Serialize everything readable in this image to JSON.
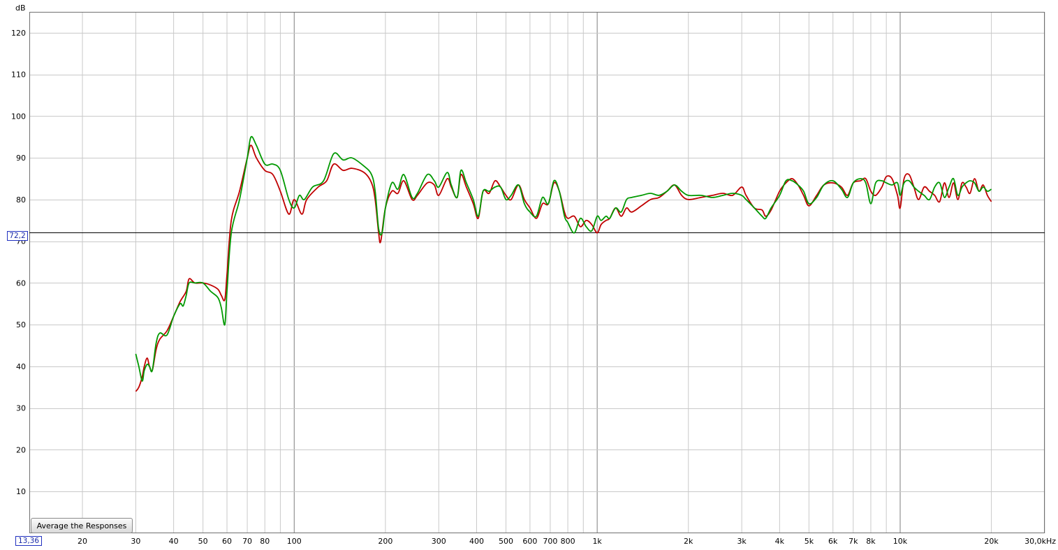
{
  "chart_data": {
    "type": "line",
    "title": "",
    "xlabel": "",
    "ylabel": "dB",
    "x_unit": "Hz",
    "x_scale": "log",
    "xlim": [
      13.36,
      30000
    ],
    "ylim": [
      0,
      125
    ],
    "grid": true,
    "x_ticks": [
      {
        "value": 20,
        "label": "20"
      },
      {
        "value": 30,
        "label": "30"
      },
      {
        "value": 40,
        "label": "40"
      },
      {
        "value": 50,
        "label": "50"
      },
      {
        "value": 60,
        "label": "60"
      },
      {
        "value": 70,
        "label": "70"
      },
      {
        "value": 80,
        "label": "80"
      },
      {
        "value": 100,
        "label": "100"
      },
      {
        "value": 200,
        "label": "200"
      },
      {
        "value": 300,
        "label": "300"
      },
      {
        "value": 400,
        "label": "400"
      },
      {
        "value": 500,
        "label": "500"
      },
      {
        "value": 600,
        "label": "600"
      },
      {
        "value": 700,
        "label": "700"
      },
      {
        "value": 800,
        "label": "800"
      },
      {
        "value": 1000,
        "label": "1k"
      },
      {
        "value": 2000,
        "label": "2k"
      },
      {
        "value": 3000,
        "label": "3k"
      },
      {
        "value": 4000,
        "label": "4k"
      },
      {
        "value": 5000,
        "label": "5k"
      },
      {
        "value": 6000,
        "label": "6k"
      },
      {
        "value": 7000,
        "label": "7k"
      },
      {
        "value": 8000,
        "label": "8k"
      },
      {
        "value": 10000,
        "label": "10k"
      },
      {
        "value": 20000,
        "label": "20k"
      },
      {
        "value": 30000,
        "label": "30,0kHz"
      }
    ],
    "x_gridlines": [
      20,
      30,
      40,
      50,
      60,
      70,
      80,
      90,
      100,
      200,
      300,
      400,
      500,
      600,
      700,
      800,
      900,
      1000,
      2000,
      3000,
      4000,
      5000,
      6000,
      7000,
      8000,
      9000,
      10000,
      20000,
      30000
    ],
    "x_major_gridlines": [
      100,
      1000,
      10000
    ],
    "y_ticks": [
      10,
      20,
      30,
      40,
      50,
      60,
      70,
      80,
      90,
      100,
      110,
      120
    ],
    "reference_line": {
      "y": 72.2,
      "label": "72,2"
    },
    "x_cursor_label": "13,36",
    "series": [
      {
        "color": "#c00000",
        "points": [
          [
            30,
            34
          ],
          [
            30.7,
            35
          ],
          [
            31.5,
            37.5
          ],
          [
            32,
            40
          ],
          [
            32.7,
            42
          ],
          [
            33.3,
            40
          ],
          [
            34,
            39
          ],
          [
            35,
            44
          ],
          [
            36,
            46.5
          ],
          [
            38,
            48.5
          ],
          [
            40,
            52
          ],
          [
            42,
            55.5
          ],
          [
            44,
            58
          ],
          [
            45,
            61
          ],
          [
            47,
            60
          ],
          [
            50,
            60
          ],
          [
            53,
            59.5
          ],
          [
            56,
            58.5
          ],
          [
            57.5,
            57
          ],
          [
            59,
            56
          ],
          [
            60,
            62
          ],
          [
            62,
            75
          ],
          [
            66,
            82
          ],
          [
            70,
            90
          ],
          [
            72,
            93
          ],
          [
            75,
            90
          ],
          [
            80,
            87
          ],
          [
            85,
            86
          ],
          [
            90,
            82
          ],
          [
            96,
            76.5
          ],
          [
            100,
            80
          ],
          [
            106,
            76.5
          ],
          [
            110,
            80
          ],
          [
            120,
            83
          ],
          [
            128,
            84.5
          ],
          [
            135,
            88.5
          ],
          [
            145,
            87
          ],
          [
            155,
            87.5
          ],
          [
            170,
            86.5
          ],
          [
            180,
            84
          ],
          [
            185,
            80
          ],
          [
            190,
            72
          ],
          [
            193,
            70
          ],
          [
            200,
            78
          ],
          [
            210,
            82
          ],
          [
            220,
            81.5
          ],
          [
            230,
            84.5
          ],
          [
            245,
            80
          ],
          [
            255,
            81
          ],
          [
            275,
            84
          ],
          [
            290,
            83.5
          ],
          [
            300,
            81
          ],
          [
            320,
            85
          ],
          [
            330,
            83
          ],
          [
            345,
            80.5
          ],
          [
            355,
            86
          ],
          [
            370,
            83
          ],
          [
            390,
            79
          ],
          [
            405,
            75.5
          ],
          [
            420,
            82
          ],
          [
            440,
            81.5
          ],
          [
            460,
            84.5
          ],
          [
            480,
            83
          ],
          [
            500,
            81
          ],
          [
            520,
            80
          ],
          [
            550,
            83.5
          ],
          [
            575,
            80
          ],
          [
            600,
            78
          ],
          [
            630,
            75.5
          ],
          [
            660,
            79
          ],
          [
            690,
            79
          ],
          [
            720,
            84
          ],
          [
            750,
            82
          ],
          [
            780,
            77
          ],
          [
            800,
            75.5
          ],
          [
            840,
            76
          ],
          [
            880,
            73.5
          ],
          [
            920,
            75
          ],
          [
            960,
            74
          ],
          [
            1000,
            72
          ],
          [
            1030,
            74
          ],
          [
            1070,
            75
          ],
          [
            1100,
            75.5
          ],
          [
            1150,
            78
          ],
          [
            1200,
            76
          ],
          [
            1250,
            78
          ],
          [
            1300,
            77
          ],
          [
            1400,
            78.5
          ],
          [
            1500,
            80
          ],
          [
            1600,
            80.5
          ],
          [
            1700,
            82
          ],
          [
            1800,
            83.5
          ],
          [
            1900,
            81
          ],
          [
            2000,
            80
          ],
          [
            2200,
            80.5
          ],
          [
            2400,
            81
          ],
          [
            2600,
            81.5
          ],
          [
            2800,
            81
          ],
          [
            3000,
            83
          ],
          [
            3100,
            81
          ],
          [
            3300,
            78
          ],
          [
            3500,
            77.5
          ],
          [
            3600,
            76
          ],
          [
            3750,
            77.5
          ],
          [
            4000,
            82
          ],
          [
            4200,
            84
          ],
          [
            4400,
            85
          ],
          [
            4600,
            83.5
          ],
          [
            4800,
            81
          ],
          [
            5000,
            78.5
          ],
          [
            5300,
            81
          ],
          [
            5600,
            83.5
          ],
          [
            6000,
            84
          ],
          [
            6400,
            83
          ],
          [
            6700,
            81
          ],
          [
            7000,
            84
          ],
          [
            7400,
            84.5
          ],
          [
            7700,
            85
          ],
          [
            8000,
            82
          ],
          [
            8300,
            81
          ],
          [
            8700,
            83
          ],
          [
            9000,
            85.5
          ],
          [
            9400,
            85
          ],
          [
            9800,
            81
          ],
          [
            10000,
            78
          ],
          [
            10300,
            85
          ],
          [
            10700,
            86
          ],
          [
            11100,
            83
          ],
          [
            11500,
            80
          ],
          [
            12000,
            83
          ],
          [
            12500,
            82
          ],
          [
            13000,
            81
          ],
          [
            13500,
            79.5
          ],
          [
            14000,
            84
          ],
          [
            14500,
            80.5
          ],
          [
            15000,
            84
          ],
          [
            15500,
            80
          ],
          [
            16000,
            84
          ],
          [
            16500,
            83
          ],
          [
            17000,
            81.5
          ],
          [
            17600,
            85
          ],
          [
            18200,
            82
          ],
          [
            18800,
            83.5
          ],
          [
            19400,
            81
          ],
          [
            20000,
            79.5
          ]
        ]
      },
      {
        "color": "#009900",
        "points": [
          [
            30,
            43
          ],
          [
            30.7,
            40
          ],
          [
            31.5,
            36.5
          ],
          [
            32,
            39
          ],
          [
            32.7,
            40.5
          ],
          [
            33.3,
            40
          ],
          [
            34,
            39
          ],
          [
            35,
            45.5
          ],
          [
            36,
            48
          ],
          [
            38,
            47.5
          ],
          [
            40,
            52
          ],
          [
            42,
            55
          ],
          [
            43,
            54.5
          ],
          [
            44,
            57
          ],
          [
            45,
            60
          ],
          [
            47,
            60
          ],
          [
            50,
            60
          ],
          [
            53,
            58
          ],
          [
            56,
            56.5
          ],
          [
            57.5,
            54
          ],
          [
            59,
            50
          ],
          [
            60,
            58
          ],
          [
            62,
            72
          ],
          [
            66,
            80
          ],
          [
            70,
            90
          ],
          [
            72,
            95
          ],
          [
            75,
            93
          ],
          [
            80,
            88.5
          ],
          [
            85,
            88.5
          ],
          [
            90,
            87
          ],
          [
            96,
            80
          ],
          [
            100,
            78
          ],
          [
            104,
            81
          ],
          [
            108,
            80
          ],
          [
            115,
            83
          ],
          [
            125,
            84.5
          ],
          [
            135,
            91
          ],
          [
            145,
            89.5
          ],
          [
            155,
            90
          ],
          [
            170,
            88
          ],
          [
            180,
            86
          ],
          [
            185,
            82
          ],
          [
            190,
            73
          ],
          [
            195,
            72
          ],
          [
            200,
            78
          ],
          [
            210,
            84
          ],
          [
            220,
            82.5
          ],
          [
            230,
            86
          ],
          [
            245,
            80.5
          ],
          [
            255,
            81.5
          ],
          [
            275,
            86
          ],
          [
            290,
            84.5
          ],
          [
            300,
            83
          ],
          [
            320,
            86.5
          ],
          [
            330,
            83.5
          ],
          [
            345,
            80.5
          ],
          [
            355,
            87
          ],
          [
            370,
            84
          ],
          [
            390,
            80
          ],
          [
            405,
            76
          ],
          [
            420,
            82
          ],
          [
            440,
            82
          ],
          [
            460,
            83
          ],
          [
            480,
            83
          ],
          [
            500,
            80
          ],
          [
            520,
            81
          ],
          [
            550,
            83.5
          ],
          [
            575,
            79
          ],
          [
            600,
            77
          ],
          [
            630,
            76
          ],
          [
            660,
            80.5
          ],
          [
            690,
            79
          ],
          [
            720,
            84.5
          ],
          [
            750,
            82
          ],
          [
            780,
            76
          ],
          [
            800,
            74.5
          ],
          [
            840,
            72
          ],
          [
            880,
            75.5
          ],
          [
            920,
            73.5
          ],
          [
            960,
            72.5
          ],
          [
            1000,
            76
          ],
          [
            1030,
            75
          ],
          [
            1070,
            76
          ],
          [
            1100,
            75.5
          ],
          [
            1150,
            78
          ],
          [
            1200,
            77
          ],
          [
            1250,
            80
          ],
          [
            1300,
            80.5
          ],
          [
            1400,
            81
          ],
          [
            1500,
            81.5
          ],
          [
            1600,
            81
          ],
          [
            1700,
            82
          ],
          [
            1800,
            83.5
          ],
          [
            1900,
            82
          ],
          [
            2000,
            81
          ],
          [
            2200,
            81
          ],
          [
            2400,
            80.5
          ],
          [
            2600,
            81
          ],
          [
            2800,
            81.5
          ],
          [
            3000,
            81
          ],
          [
            3100,
            80
          ],
          [
            3300,
            78
          ],
          [
            3500,
            76
          ],
          [
            3600,
            75.5
          ],
          [
            3750,
            78
          ],
          [
            4000,
            81
          ],
          [
            4200,
            84.5
          ],
          [
            4400,
            84.5
          ],
          [
            4600,
            83.5
          ],
          [
            4800,
            82
          ],
          [
            5000,
            79
          ],
          [
            5300,
            80.5
          ],
          [
            5600,
            83.5
          ],
          [
            6000,
            84.5
          ],
          [
            6400,
            82.5
          ],
          [
            6700,
            80.5
          ],
          [
            7000,
            84
          ],
          [
            7400,
            85
          ],
          [
            7700,
            84
          ],
          [
            8000,
            79
          ],
          [
            8300,
            84
          ],
          [
            8700,
            84.5
          ],
          [
            9000,
            84
          ],
          [
            9400,
            83.5
          ],
          [
            9800,
            84
          ],
          [
            10000,
            81
          ],
          [
            10300,
            84
          ],
          [
            10700,
            84.5
          ],
          [
            11100,
            83
          ],
          [
            11500,
            82
          ],
          [
            12000,
            81
          ],
          [
            12500,
            80
          ],
          [
            13000,
            83
          ],
          [
            13500,
            84
          ],
          [
            14000,
            80.5
          ],
          [
            14500,
            83
          ],
          [
            15000,
            85
          ],
          [
            15500,
            81
          ],
          [
            16000,
            83
          ],
          [
            16500,
            84
          ],
          [
            17000,
            84.5
          ],
          [
            17600,
            84
          ],
          [
            18200,
            82
          ],
          [
            18800,
            83
          ],
          [
            19400,
            82
          ],
          [
            20000,
            82.5
          ]
        ]
      }
    ]
  },
  "ui": {
    "average_button_label": "Average the Responses"
  }
}
